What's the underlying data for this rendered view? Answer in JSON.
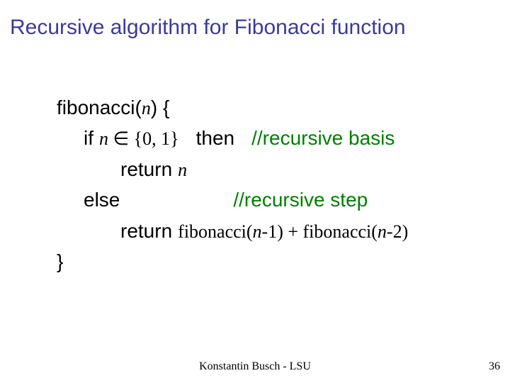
{
  "title": "Recursive algorithm for Fibonacci function",
  "code": {
    "line1_a": "fibonacci(",
    "line1_param": "n",
    "line1_b": ") {",
    "line2_if": "if",
    "line2_cond_pre": "n",
    "line2_cond_mid": " ∈ {0, 1}",
    "line2_then": "then",
    "line2_comment": "//recursive basis",
    "line3_return": "return",
    "line3_val": "n",
    "line4_else": "else",
    "line4_comment": "//recursive step",
    "line5_return": "return",
    "line5_expr_a": "fibonacci(",
    "line5_expr_n1": "n",
    "line5_expr_b": "-1) + fibonacci(",
    "line5_expr_n2": "n",
    "line5_expr_c": "-2)",
    "line6": "}"
  },
  "footer": "Konstantin Busch - LSU",
  "page": "36"
}
